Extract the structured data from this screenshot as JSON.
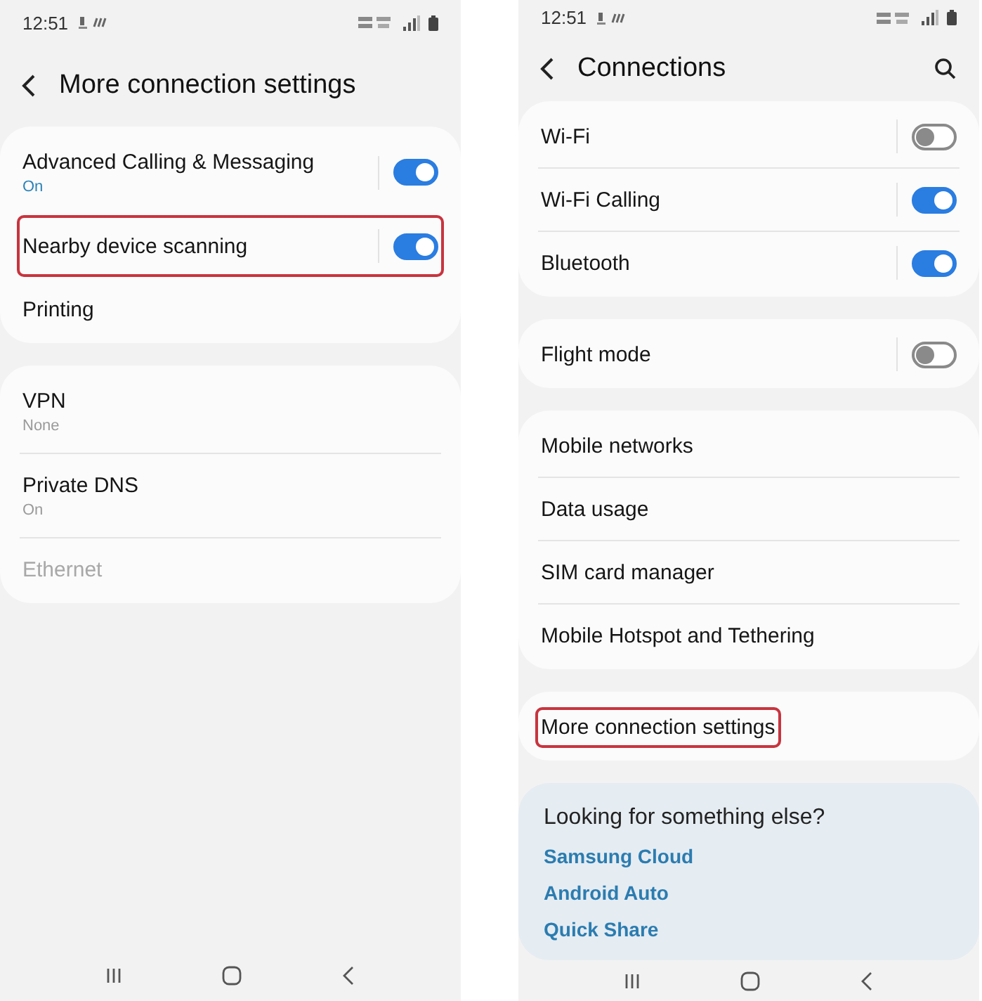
{
  "screens": [
    {
      "status_bar": {
        "time": "12:51"
      },
      "header": {
        "title": "More connection settings",
        "search": false
      },
      "groups": [
        {
          "tinted": false,
          "divided": false,
          "items": [
            {
              "kind": "toggle",
              "label": "Advanced Calling & Messaging",
              "subtitle": "On",
              "subtitle_accent": true,
              "on": true,
              "highlighted": false,
              "disabled": false
            },
            {
              "kind": "toggle",
              "label": "Nearby device scanning",
              "on": true,
              "highlighted": true,
              "disabled": false
            },
            {
              "kind": "plain",
              "label": "Printing",
              "highlighted": false,
              "disabled": false
            }
          ]
        },
        {
          "tinted": false,
          "divided": true,
          "items": [
            {
              "kind": "plain",
              "label": "VPN",
              "subtitle": "None",
              "subtitle_accent": false,
              "highlighted": false,
              "disabled": false
            },
            {
              "kind": "plain",
              "label": "Private DNS",
              "subtitle": "On",
              "subtitle_accent": false,
              "highlighted": false,
              "disabled": false
            },
            {
              "kind": "plain",
              "label": "Ethernet",
              "highlighted": false,
              "disabled": true
            }
          ]
        }
      ]
    },
    {
      "status_bar": {
        "time": "12:51"
      },
      "header": {
        "title": "Connections",
        "search": true
      },
      "groups": [
        {
          "tinted": false,
          "divided": true,
          "items": [
            {
              "kind": "toggle",
              "label": "Wi-Fi",
              "on": false,
              "highlighted": false,
              "disabled": false
            },
            {
              "kind": "toggle",
              "label": "Wi-Fi Calling",
              "on": true,
              "highlighted": false,
              "disabled": false
            },
            {
              "kind": "toggle",
              "label": "Bluetooth",
              "on": true,
              "highlighted": false,
              "disabled": false
            }
          ]
        },
        {
          "tinted": false,
          "items": [
            {
              "kind": "toggle",
              "label": "Flight mode",
              "on": false,
              "highlighted": false,
              "disabled": false
            }
          ]
        },
        {
          "tinted": false,
          "divided": true,
          "items": [
            {
              "kind": "plain",
              "label": "Mobile networks",
              "highlighted": false,
              "disabled": false
            },
            {
              "kind": "plain",
              "label": "Data usage",
              "highlighted": false,
              "disabled": false
            },
            {
              "kind": "plain",
              "label": "SIM card manager",
              "highlighted": false,
              "disabled": false
            },
            {
              "kind": "plain",
              "label": "Mobile Hotspot and Tethering",
              "highlighted": false,
              "disabled": false
            }
          ]
        },
        {
          "tinted": false,
          "items": [
            {
              "kind": "plain",
              "label": "More connection settings",
              "highlighted": true,
              "disabled": false
            }
          ]
        },
        {
          "tinted": true,
          "divided": false,
          "title": "Looking for something else?",
          "items": [
            {
              "kind": "link",
              "label": "Samsung Cloud"
            },
            {
              "kind": "link",
              "label": "Android Auto"
            },
            {
              "kind": "link",
              "label": "Quick Share"
            }
          ]
        }
      ]
    }
  ]
}
